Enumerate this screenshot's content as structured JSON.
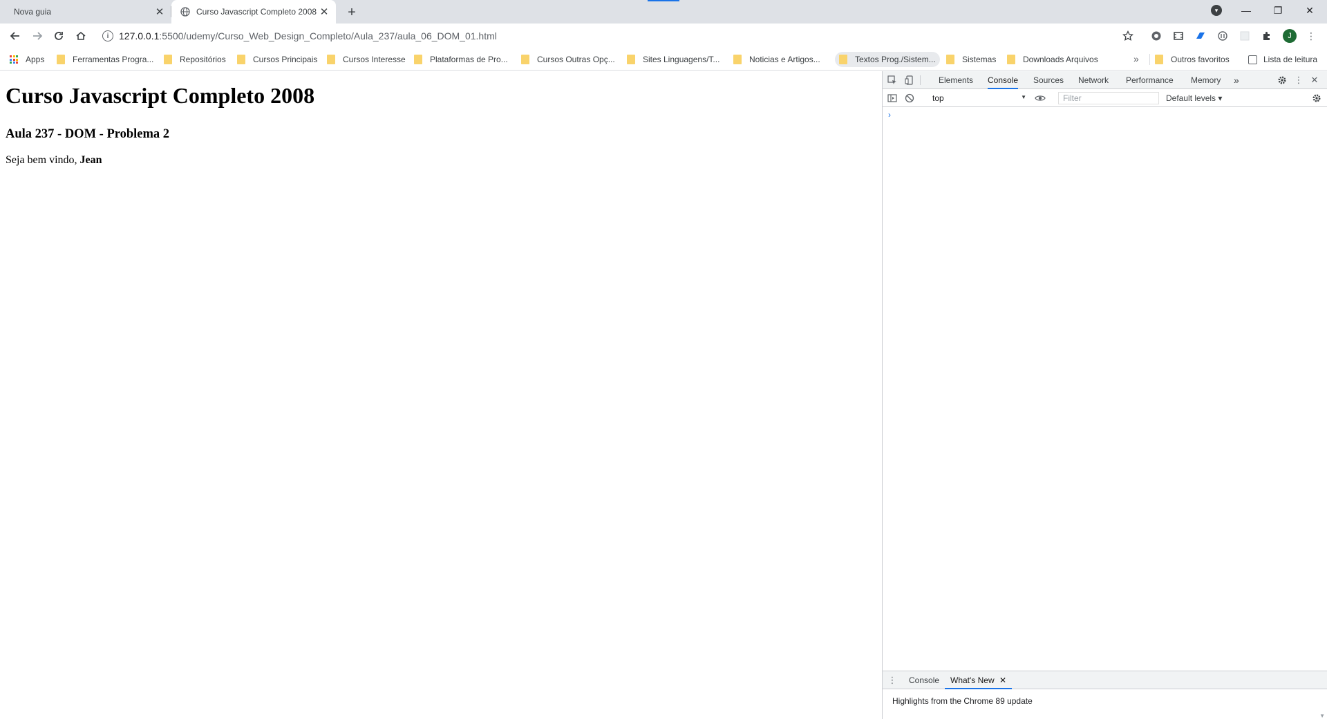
{
  "tabs": [
    {
      "title": "Nova guia",
      "close": "✕"
    },
    {
      "title": "Curso Javascript Completo 2008",
      "close": "✕"
    }
  ],
  "new_tab": "+",
  "window_controls": {
    "minimize": "—",
    "restore": "❐",
    "close": "✕"
  },
  "address_bar": {
    "host": "127.0.0.1",
    "path": ":5500/udemy/Curso_Web_Design_Completo/Aula_237/aula_06_DOM_01.html"
  },
  "profile_initial": "J",
  "bookmarks": [
    {
      "label": "Apps",
      "icon": "apps-grid-icon"
    },
    {
      "label": "Ferramentas Progra...",
      "icon": "folder-icon"
    },
    {
      "label": "Repositórios",
      "icon": "folder-icon"
    },
    {
      "label": "Cursos Principais",
      "icon": "folder-icon"
    },
    {
      "label": "Cursos Interesse",
      "icon": "folder-icon"
    },
    {
      "label": "Plataformas de Pro...",
      "icon": "folder-icon"
    },
    {
      "label": "Cursos Outras Opç...",
      "icon": "folder-icon"
    },
    {
      "label": "Sites Linguagens/T...",
      "icon": "folder-icon"
    },
    {
      "label": "Noticias e Artigos...",
      "icon": "folder-icon"
    },
    {
      "label": "Textos Prog./Sistem...",
      "icon": "folder-icon"
    },
    {
      "label": "Sistemas",
      "icon": "folder-icon"
    },
    {
      "label": "Downloads Arquivos",
      "icon": "folder-icon"
    }
  ],
  "bookmarks_overflow": "»",
  "other_bookmarks": "Outros favoritos",
  "reading_list": "Lista de leitura",
  "page": {
    "heading": "Curso Javascript Completo 2008",
    "subheading": "Aula 237 - DOM - Problema 2",
    "greeting": "Seja bem vindo, ",
    "name": "Jean"
  },
  "devtools": {
    "tabs": [
      "Elements",
      "Console",
      "Sources",
      "Network",
      "Performance",
      "Memory"
    ],
    "selected_tab": "Console",
    "more_tabs": "»",
    "context": "top",
    "filter_placeholder": "Filter",
    "levels": "Default levels ▾",
    "prompt": "›",
    "drawer_tabs": [
      "Console",
      "What's New"
    ],
    "drawer_close": "✕",
    "drawer_message": "Highlights from the Chrome 89 update"
  },
  "colors": {
    "accent": "#1a73e8",
    "tabstrip": "#dee1e6",
    "folder": "#f9d36b",
    "profile": "#1e6b34"
  }
}
